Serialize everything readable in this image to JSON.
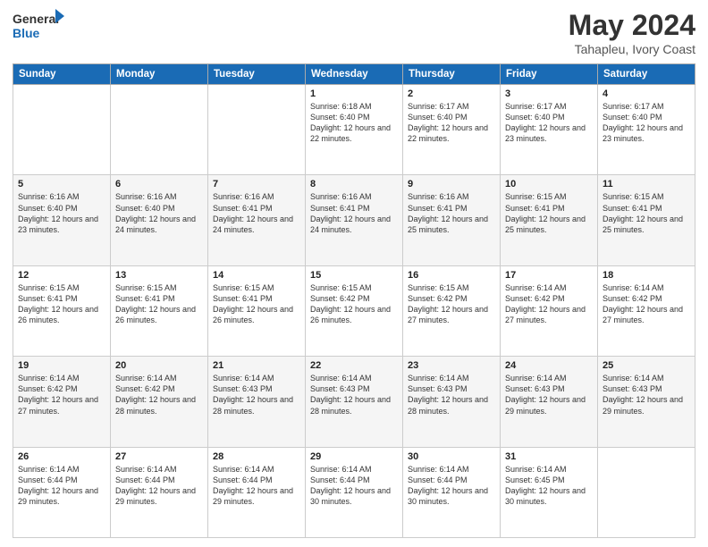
{
  "header": {
    "logo_line1": "General",
    "logo_line2": "Blue",
    "month": "May 2024",
    "location": "Tahapleu, Ivory Coast"
  },
  "days_of_week": [
    "Sunday",
    "Monday",
    "Tuesday",
    "Wednesday",
    "Thursday",
    "Friday",
    "Saturday"
  ],
  "weeks": [
    [
      {
        "day": "",
        "sunrise": "",
        "sunset": "",
        "daylight": ""
      },
      {
        "day": "",
        "sunrise": "",
        "sunset": "",
        "daylight": ""
      },
      {
        "day": "",
        "sunrise": "",
        "sunset": "",
        "daylight": ""
      },
      {
        "day": "1",
        "sunrise": "Sunrise: 6:18 AM",
        "sunset": "Sunset: 6:40 PM",
        "daylight": "Daylight: 12 hours and 22 minutes."
      },
      {
        "day": "2",
        "sunrise": "Sunrise: 6:17 AM",
        "sunset": "Sunset: 6:40 PM",
        "daylight": "Daylight: 12 hours and 22 minutes."
      },
      {
        "day": "3",
        "sunrise": "Sunrise: 6:17 AM",
        "sunset": "Sunset: 6:40 PM",
        "daylight": "Daylight: 12 hours and 23 minutes."
      },
      {
        "day": "4",
        "sunrise": "Sunrise: 6:17 AM",
        "sunset": "Sunset: 6:40 PM",
        "daylight": "Daylight: 12 hours and 23 minutes."
      }
    ],
    [
      {
        "day": "5",
        "sunrise": "Sunrise: 6:16 AM",
        "sunset": "Sunset: 6:40 PM",
        "daylight": "Daylight: 12 hours and 23 minutes."
      },
      {
        "day": "6",
        "sunrise": "Sunrise: 6:16 AM",
        "sunset": "Sunset: 6:40 PM",
        "daylight": "Daylight: 12 hours and 24 minutes."
      },
      {
        "day": "7",
        "sunrise": "Sunrise: 6:16 AM",
        "sunset": "Sunset: 6:41 PM",
        "daylight": "Daylight: 12 hours and 24 minutes."
      },
      {
        "day": "8",
        "sunrise": "Sunrise: 6:16 AM",
        "sunset": "Sunset: 6:41 PM",
        "daylight": "Daylight: 12 hours and 24 minutes."
      },
      {
        "day": "9",
        "sunrise": "Sunrise: 6:16 AM",
        "sunset": "Sunset: 6:41 PM",
        "daylight": "Daylight: 12 hours and 25 minutes."
      },
      {
        "day": "10",
        "sunrise": "Sunrise: 6:15 AM",
        "sunset": "Sunset: 6:41 PM",
        "daylight": "Daylight: 12 hours and 25 minutes."
      },
      {
        "day": "11",
        "sunrise": "Sunrise: 6:15 AM",
        "sunset": "Sunset: 6:41 PM",
        "daylight": "Daylight: 12 hours and 25 minutes."
      }
    ],
    [
      {
        "day": "12",
        "sunrise": "Sunrise: 6:15 AM",
        "sunset": "Sunset: 6:41 PM",
        "daylight": "Daylight: 12 hours and 26 minutes."
      },
      {
        "day": "13",
        "sunrise": "Sunrise: 6:15 AM",
        "sunset": "Sunset: 6:41 PM",
        "daylight": "Daylight: 12 hours and 26 minutes."
      },
      {
        "day": "14",
        "sunrise": "Sunrise: 6:15 AM",
        "sunset": "Sunset: 6:41 PM",
        "daylight": "Daylight: 12 hours and 26 minutes."
      },
      {
        "day": "15",
        "sunrise": "Sunrise: 6:15 AM",
        "sunset": "Sunset: 6:42 PM",
        "daylight": "Daylight: 12 hours and 26 minutes."
      },
      {
        "day": "16",
        "sunrise": "Sunrise: 6:15 AM",
        "sunset": "Sunset: 6:42 PM",
        "daylight": "Daylight: 12 hours and 27 minutes."
      },
      {
        "day": "17",
        "sunrise": "Sunrise: 6:14 AM",
        "sunset": "Sunset: 6:42 PM",
        "daylight": "Daylight: 12 hours and 27 minutes."
      },
      {
        "day": "18",
        "sunrise": "Sunrise: 6:14 AM",
        "sunset": "Sunset: 6:42 PM",
        "daylight": "Daylight: 12 hours and 27 minutes."
      }
    ],
    [
      {
        "day": "19",
        "sunrise": "Sunrise: 6:14 AM",
        "sunset": "Sunset: 6:42 PM",
        "daylight": "Daylight: 12 hours and 27 minutes."
      },
      {
        "day": "20",
        "sunrise": "Sunrise: 6:14 AM",
        "sunset": "Sunset: 6:42 PM",
        "daylight": "Daylight: 12 hours and 28 minutes."
      },
      {
        "day": "21",
        "sunrise": "Sunrise: 6:14 AM",
        "sunset": "Sunset: 6:43 PM",
        "daylight": "Daylight: 12 hours and 28 minutes."
      },
      {
        "day": "22",
        "sunrise": "Sunrise: 6:14 AM",
        "sunset": "Sunset: 6:43 PM",
        "daylight": "Daylight: 12 hours and 28 minutes."
      },
      {
        "day": "23",
        "sunrise": "Sunrise: 6:14 AM",
        "sunset": "Sunset: 6:43 PM",
        "daylight": "Daylight: 12 hours and 28 minutes."
      },
      {
        "day": "24",
        "sunrise": "Sunrise: 6:14 AM",
        "sunset": "Sunset: 6:43 PM",
        "daylight": "Daylight: 12 hours and 29 minutes."
      },
      {
        "day": "25",
        "sunrise": "Sunrise: 6:14 AM",
        "sunset": "Sunset: 6:43 PM",
        "daylight": "Daylight: 12 hours and 29 minutes."
      }
    ],
    [
      {
        "day": "26",
        "sunrise": "Sunrise: 6:14 AM",
        "sunset": "Sunset: 6:44 PM",
        "daylight": "Daylight: 12 hours and 29 minutes."
      },
      {
        "day": "27",
        "sunrise": "Sunrise: 6:14 AM",
        "sunset": "Sunset: 6:44 PM",
        "daylight": "Daylight: 12 hours and 29 minutes."
      },
      {
        "day": "28",
        "sunrise": "Sunrise: 6:14 AM",
        "sunset": "Sunset: 6:44 PM",
        "daylight": "Daylight: 12 hours and 29 minutes."
      },
      {
        "day": "29",
        "sunrise": "Sunrise: 6:14 AM",
        "sunset": "Sunset: 6:44 PM",
        "daylight": "Daylight: 12 hours and 30 minutes."
      },
      {
        "day": "30",
        "sunrise": "Sunrise: 6:14 AM",
        "sunset": "Sunset: 6:44 PM",
        "daylight": "Daylight: 12 hours and 30 minutes."
      },
      {
        "day": "31",
        "sunrise": "Sunrise: 6:14 AM",
        "sunset": "Sunset: 6:45 PM",
        "daylight": "Daylight: 12 hours and 30 minutes."
      },
      {
        "day": "",
        "sunrise": "",
        "sunset": "",
        "daylight": ""
      }
    ]
  ]
}
